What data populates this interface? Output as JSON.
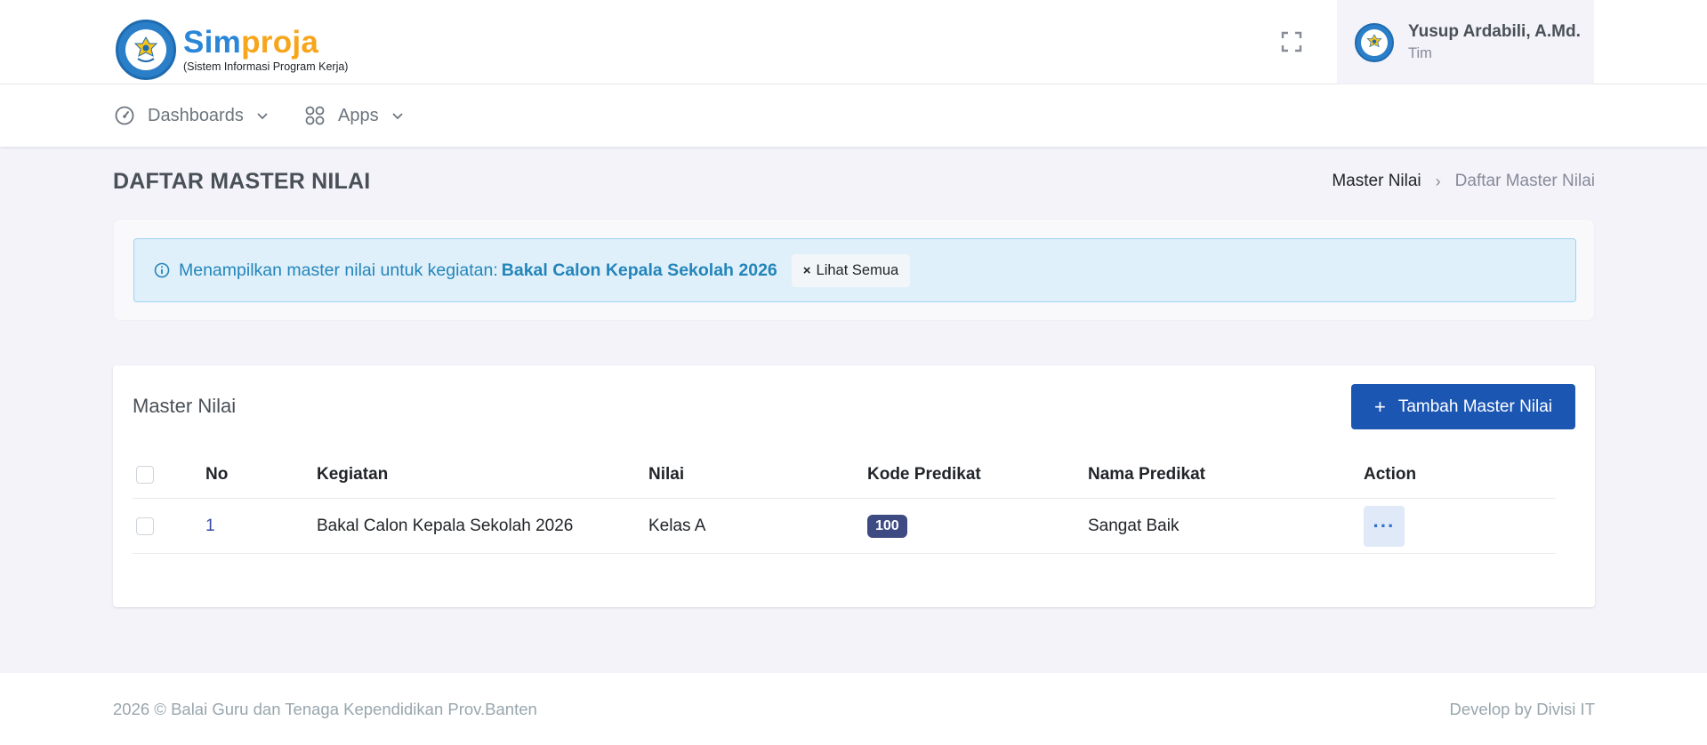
{
  "brand": {
    "name_part1": "Sim",
    "name_part2": "proja",
    "subtitle": "(Sistem Informasi Program Kerja)"
  },
  "user": {
    "name": "Yusup Ardabili, A.Md.",
    "role": "Tim"
  },
  "nav": {
    "dashboards": "Dashboards",
    "apps": "Apps"
  },
  "page": {
    "title": "DAFTAR MASTER NILAI",
    "breadcrumb": [
      "Master Nilai",
      "Daftar Master Nilai"
    ]
  },
  "alert": {
    "message": "Menampilkan master nilai untuk kegiatan:",
    "kegiatan": "Bakal Calon Kepala Sekolah 2026",
    "clear_label": "Lihat Semua"
  },
  "table_card": {
    "title": "Master Nilai",
    "add_button": "Tambah Master Nilai",
    "columns": [
      "No",
      "Kegiatan",
      "Nilai",
      "Kode Predikat",
      "Nama Predikat",
      "Action"
    ],
    "rows": [
      {
        "no": "1",
        "kegiatan": "Bakal Calon Kepala Sekolah 2026",
        "nilai": "Kelas A",
        "kode_predikat": "100",
        "nama_predikat": "Sangat Baik"
      }
    ]
  },
  "footer": {
    "left": "2026 © Balai Guru dan Tenaga Kependidikan Prov.Banten",
    "right": "Develop by Divisi IT"
  },
  "colors": {
    "brand_blue": "#2a86d6",
    "brand_orange": "#f7a51b",
    "primary_button": "#1c56b3",
    "badge": "#3d4b82",
    "alert_bg": "#dff0fa",
    "alert_text": "#2385ba"
  }
}
